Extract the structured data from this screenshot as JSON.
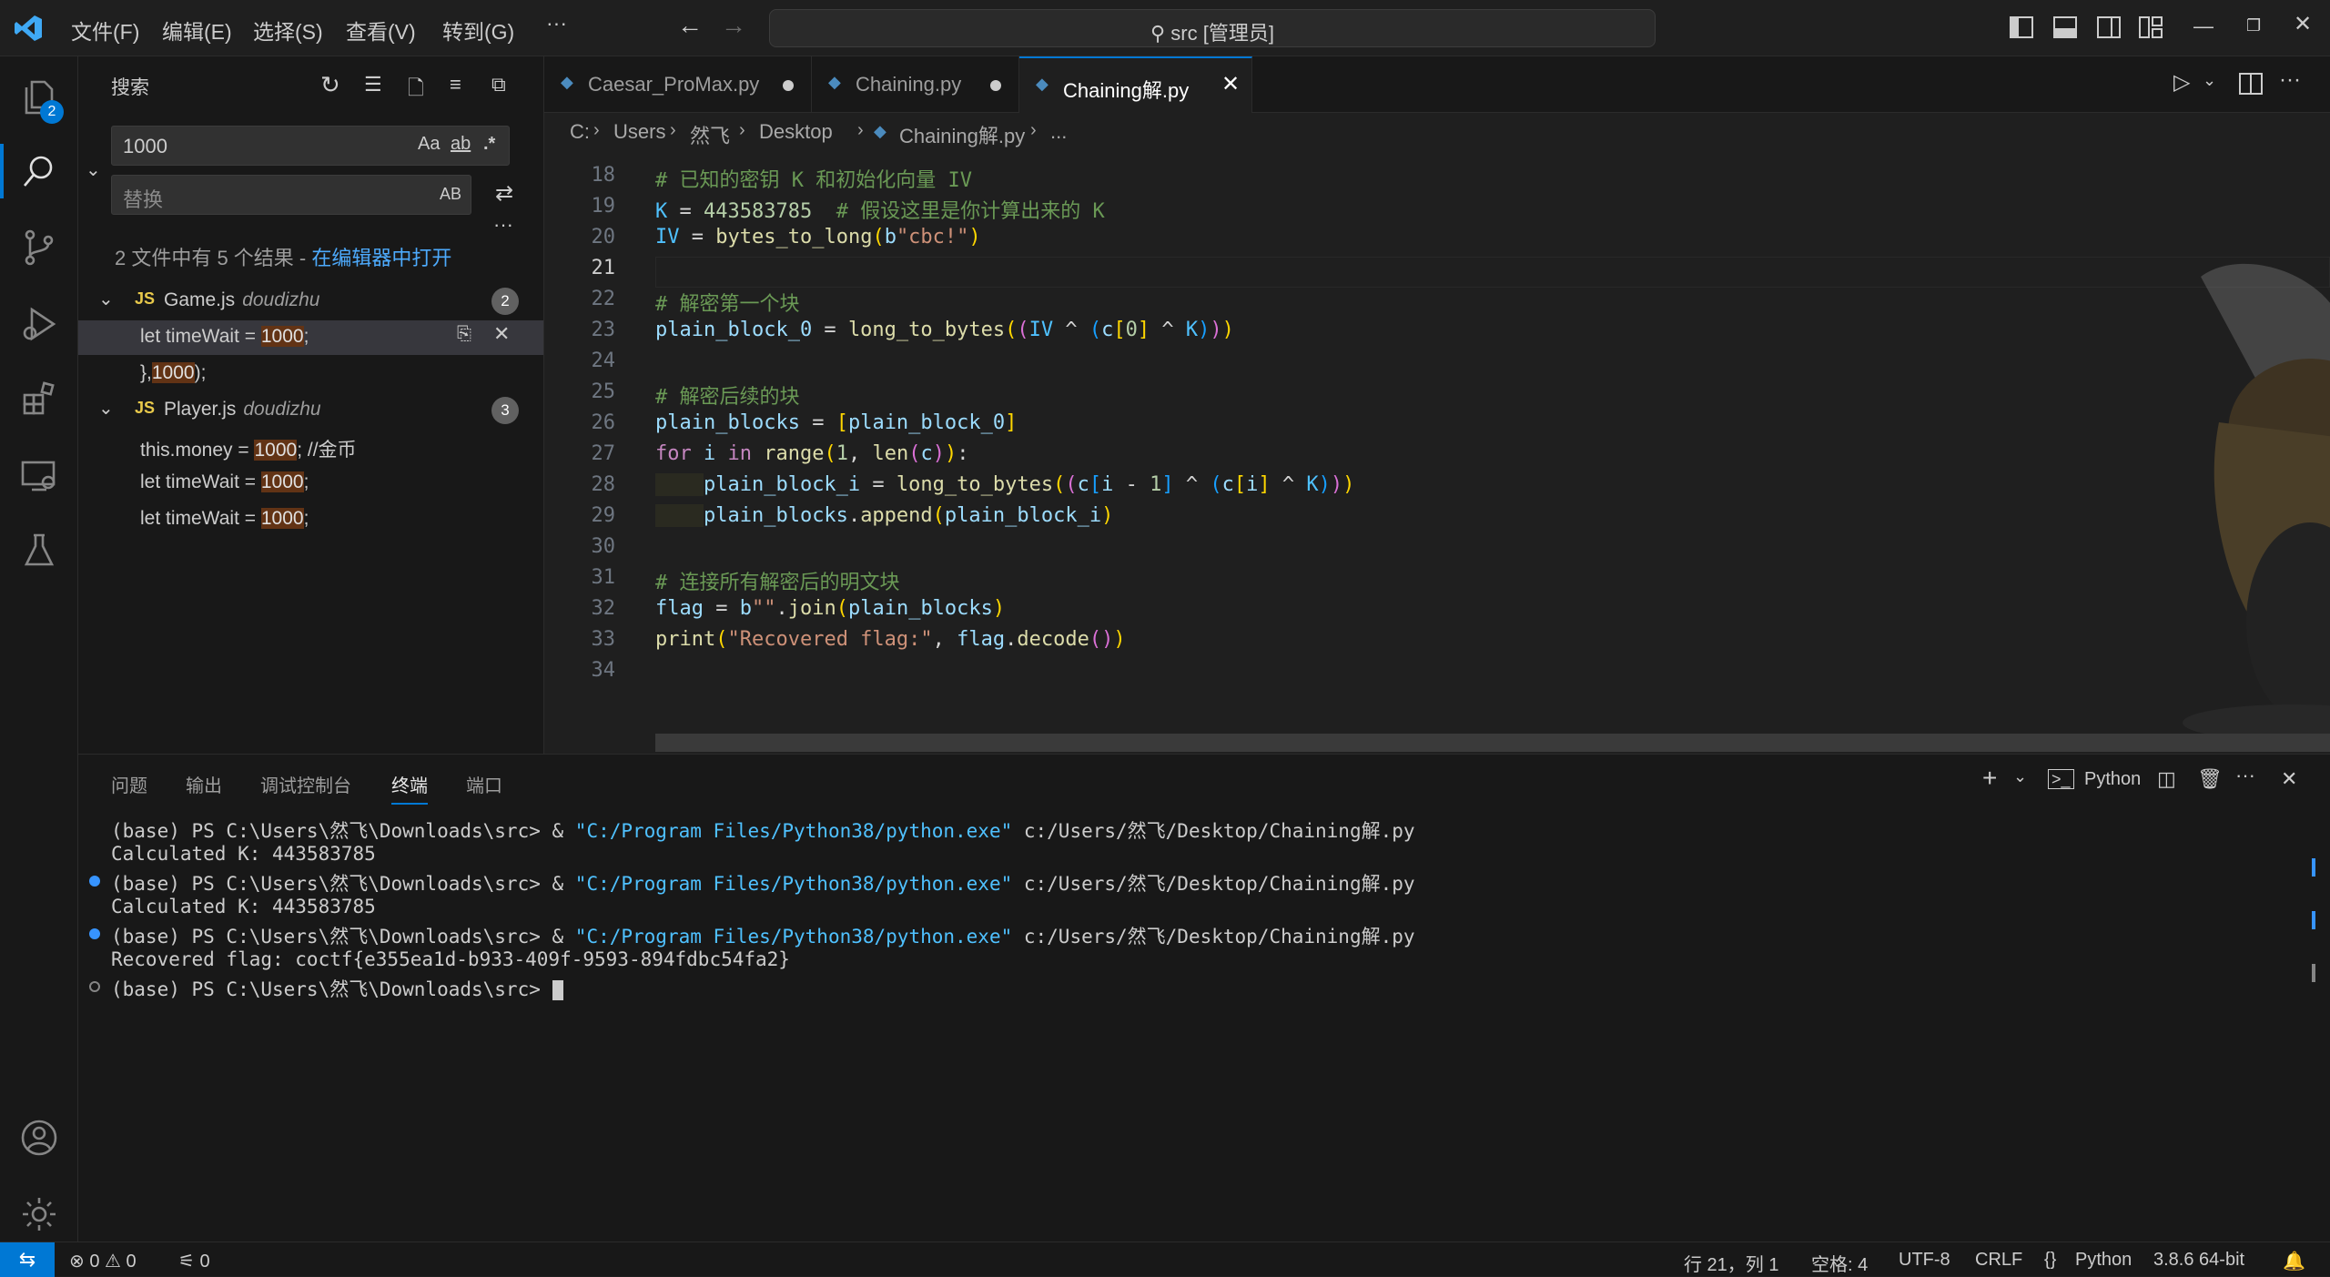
{
  "titlebar": {
    "menus": [
      "文件(F)",
      "编辑(E)",
      "选择(S)",
      "查看(V)",
      "转到(G)",
      "···"
    ],
    "search_text": "src [管理员]",
    "back_icon": "arrow-left-icon",
    "forward_icon": "arrow-right-icon"
  },
  "activity": {
    "explorer_badge": "2"
  },
  "sidebar": {
    "title": "搜索",
    "search_value": "1000",
    "search_opts": [
      "Aa",
      "ab",
      ".*"
    ],
    "replace_placeholder": "替换",
    "replace_opt": "AB",
    "more": "···",
    "summary": "2 文件中有 5 个结果 - ",
    "open_in_editor": "在编辑器中打开",
    "files": [
      {
        "name": "Game.js",
        "path": "doudizhu",
        "count": "2",
        "matches": [
          {
            "pre": "let timeWait = ",
            "hit": "1000",
            "post": ";"
          },
          {
            "pre": "},",
            "hit": "1000",
            "post": ");"
          }
        ]
      },
      {
        "name": "Player.js",
        "path": "doudizhu",
        "count": "3",
        "matches": [
          {
            "pre": "this.money = ",
            "hit": "1000",
            "post": "; //金币"
          },
          {
            "pre": "let timeWait = ",
            "hit": "1000",
            "post": ";"
          },
          {
            "pre": "let timeWait = ",
            "hit": "1000",
            "post": ";"
          }
        ]
      }
    ],
    "js_label": "JS"
  },
  "tabs": [
    {
      "label": "Caesar_ProMax.py",
      "modified": true
    },
    {
      "label": "Chaining.py",
      "modified": true
    },
    {
      "label": "Chaining解.py",
      "active": true
    }
  ],
  "breadcrumb": [
    "C:",
    "Users",
    "然飞",
    "Desktop",
    "Chaining解.py",
    "..."
  ],
  "editor": {
    "line_numbers": [
      "18",
      "19",
      "20",
      "21",
      "22",
      "23",
      "24",
      "25",
      "26",
      "27",
      "28",
      "29",
      "30",
      "31",
      "32",
      "33",
      "34"
    ],
    "current_line": "21"
  },
  "panel": {
    "tabs": [
      "问题",
      "输出",
      "调试控制台",
      "终端",
      "端口"
    ],
    "active_tab": "终端",
    "terminal_kind": "Python",
    "lines": [
      {
        "prompt": "(base) PS C:\\Users\\然飞\\Downloads\\src> & ",
        "q": "\"C:/Program Files/Python38/python.exe\"",
        "rest": " c:/Users/然飞/Desktop/Chaining解.py"
      },
      {
        "text": "Calculated K: 443583785"
      },
      {
        "prompt": "(base) PS C:\\Users\\然飞\\Downloads\\src> & ",
        "q": "\"C:/Program Files/Python38/python.exe\"",
        "rest": " c:/Users/然飞/Desktop/Chaining解.py"
      },
      {
        "text": "Calculated K: 443583785"
      },
      {
        "prompt": "(base) PS C:\\Users\\然飞\\Downloads\\src> & ",
        "q": "\"C:/Program Files/Python38/python.exe\"",
        "rest": " c:/Users/然飞/Desktop/Chaining解.py"
      },
      {
        "text": "Recovered flag: coctf{e355ea1d-b933-409f-9593-894fdbc54fa2}"
      },
      {
        "prompt": "(base) PS C:\\Users\\然飞\\Downloads\\src> ",
        "q": "",
        "rest": ""
      }
    ]
  },
  "status": {
    "errors": "0",
    "warnings": "0",
    "ports": "0",
    "position": "行 21，列 1",
    "spaces": "空格: 4",
    "encoding": "UTF-8",
    "eol": "CRLF",
    "language": "Python",
    "interpreter": "3.8.6 64-bit"
  }
}
